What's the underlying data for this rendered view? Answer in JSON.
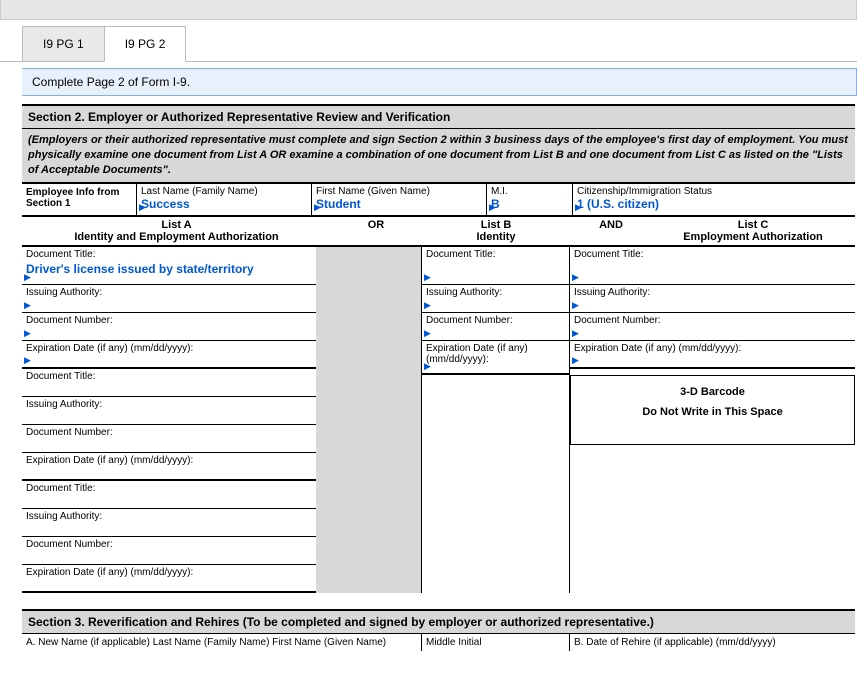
{
  "tabs": {
    "pg1": "I9 PG 1",
    "pg2": "I9 PG 2"
  },
  "notice": "Complete Page 2 of Form I-9.",
  "section2": {
    "title": "Section 2.  Employer or Authorized Representative Review and Verification",
    "instructions": "(Employers or their authorized representative must complete and sign Section 2 within 3 business days of the employee's first day of employment. You must physically examine one document from List A OR examine a combination of one document from List B and one document from List C as listed on the \"Lists of Acceptable Documents\".",
    "emp_info_label": "Employee Info from Section 1",
    "last_name_label": "Last Name (Family Name)",
    "last_name_value": "Success",
    "first_name_label": "First Name (Given Name)",
    "first_name_value": "Student",
    "mi_label": "M.I.",
    "mi_value": "B",
    "citizenship_label": "Citizenship/Immigration Status",
    "citizenship_value": "1 (U.S. citizen)"
  },
  "lists": {
    "list_a": "List A",
    "list_a_sub": "Identity and Employment Authorization",
    "or": "OR",
    "list_b": "List B",
    "list_b_sub": "Identity",
    "and": "AND",
    "list_c": "List C",
    "list_c_sub": "Employment Authorization"
  },
  "labels": {
    "doc_title": "Document Title:",
    "issuing_authority": "Issuing Authority:",
    "doc_number": "Document Number:",
    "exp_date": "Expiration Date (if any) (mm/dd/yyyy):"
  },
  "values": {
    "list_a_doc1_title": "Driver's license issued by state/territory"
  },
  "barcode": {
    "line1": "3-D Barcode",
    "line2": "Do Not Write in This Space"
  },
  "section3": {
    "title": "Section 3. Reverification and Rehires (To be completed and signed by employer or authorized representative.)",
    "a": "A. New Name (if applicable) Last Name (Family Name) First Name (Given Name)",
    "mi": "Middle Initial",
    "b": "B. Date of Rehire (if applicable) (mm/dd/yyyy)"
  }
}
